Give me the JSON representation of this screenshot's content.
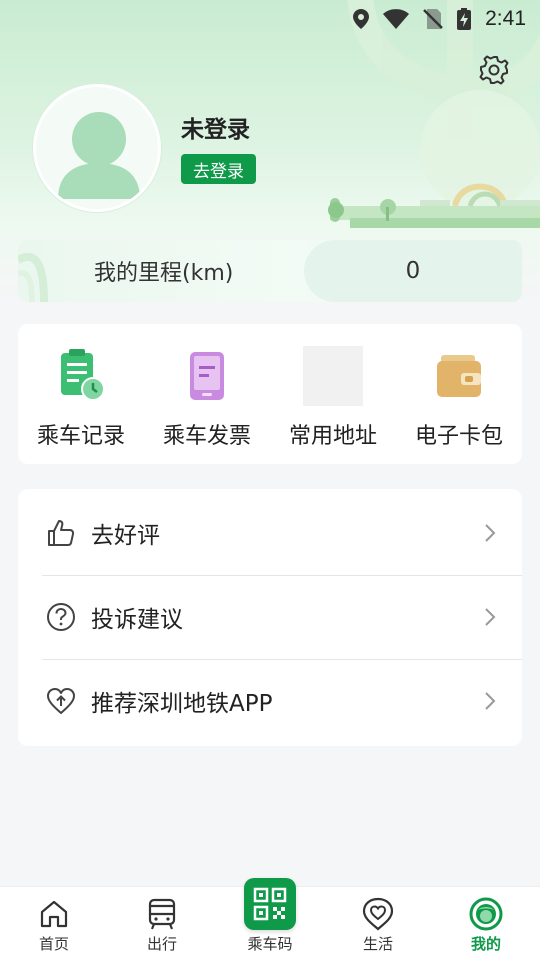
{
  "status_bar": {
    "time": "2:41"
  },
  "profile": {
    "username": "未登录",
    "login_button": "去登录"
  },
  "mileage": {
    "label": "我的里程(km)",
    "value": "0"
  },
  "quick_actions": [
    {
      "label": "乘车记录",
      "icon": "ride-record-icon"
    },
    {
      "label": "乘车发票",
      "icon": "ride-invoice-icon"
    },
    {
      "label": "常用地址",
      "icon": "placeholder-icon"
    },
    {
      "label": "电子卡包",
      "icon": "wallet-icon"
    }
  ],
  "menu": [
    {
      "label": "去好评",
      "icon": "thumbs-up-icon"
    },
    {
      "label": "投诉建议",
      "icon": "question-circle-icon"
    },
    {
      "label": "推荐深圳地铁APP",
      "icon": "heart-share-icon"
    }
  ],
  "tabbar": [
    {
      "label": "首页",
      "icon": "home-icon"
    },
    {
      "label": "出行",
      "icon": "bus-icon"
    },
    {
      "label": "乘车码",
      "icon": "qr-code-icon"
    },
    {
      "label": "生活",
      "icon": "heart-location-icon"
    },
    {
      "label": "我的",
      "icon": "profile-active-icon"
    }
  ],
  "colors": {
    "brand_green": "#0f9a4a",
    "header_green": "#c9ecd1"
  }
}
